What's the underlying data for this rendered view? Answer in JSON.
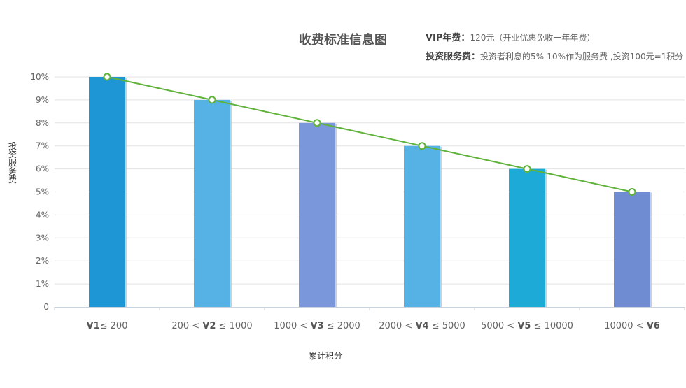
{
  "header": {
    "title": "收费标准信息图",
    "vip_label": "VIP年费：",
    "vip_text": "120元（开业优惠免收一年年费）",
    "service_label": "投资服务费：",
    "service_text": "投资者利息的5%-10%作为服务费 ,投资100元=1积分"
  },
  "chart_data": {
    "type": "bar",
    "title": "收费标准信息图",
    "xlabel": "累计积分",
    "ylabel": "投资服务费",
    "ylim": [
      0,
      10
    ],
    "y_ticks": [
      "0",
      "1%",
      "2%",
      "3%",
      "4%",
      "5%",
      "6%",
      "7%",
      "8%",
      "9%",
      "10%"
    ],
    "categories": [
      [
        {
          "t": "V1",
          "b": true
        },
        {
          "t": "≤ 200",
          "b": false
        }
      ],
      [
        {
          "t": "200 < ",
          "b": false
        },
        {
          "t": "V2",
          "b": true
        },
        {
          "t": " ≤ 1000",
          "b": false
        }
      ],
      [
        {
          "t": "1000 < ",
          "b": false
        },
        {
          "t": "V3",
          "b": true
        },
        {
          "t": " ≤ 2000",
          "b": false
        }
      ],
      [
        {
          "t": "2000 < ",
          "b": false
        },
        {
          "t": "V4",
          "b": true
        },
        {
          "t": " ≤ 5000",
          "b": false
        }
      ],
      [
        {
          "t": "5000 < ",
          "b": false
        },
        {
          "t": "V5",
          "b": true
        },
        {
          "t": " ≤ 10000",
          "b": false
        }
      ],
      [
        {
          "t": "10000 < ",
          "b": false
        },
        {
          "t": "V6",
          "b": true
        }
      ]
    ],
    "values": [
      10,
      9,
      8,
      7,
      6,
      5
    ],
    "line_values": [
      10,
      9,
      8,
      7,
      6,
      5
    ],
    "bar_colors": [
      "#1e96d6",
      "#56b1e5",
      "#7b97db",
      "#56b1e5",
      "#1eaad6",
      "#6f8cd3"
    ],
    "line_color": "#5fb23a",
    "grid": true,
    "legend": "none"
  }
}
